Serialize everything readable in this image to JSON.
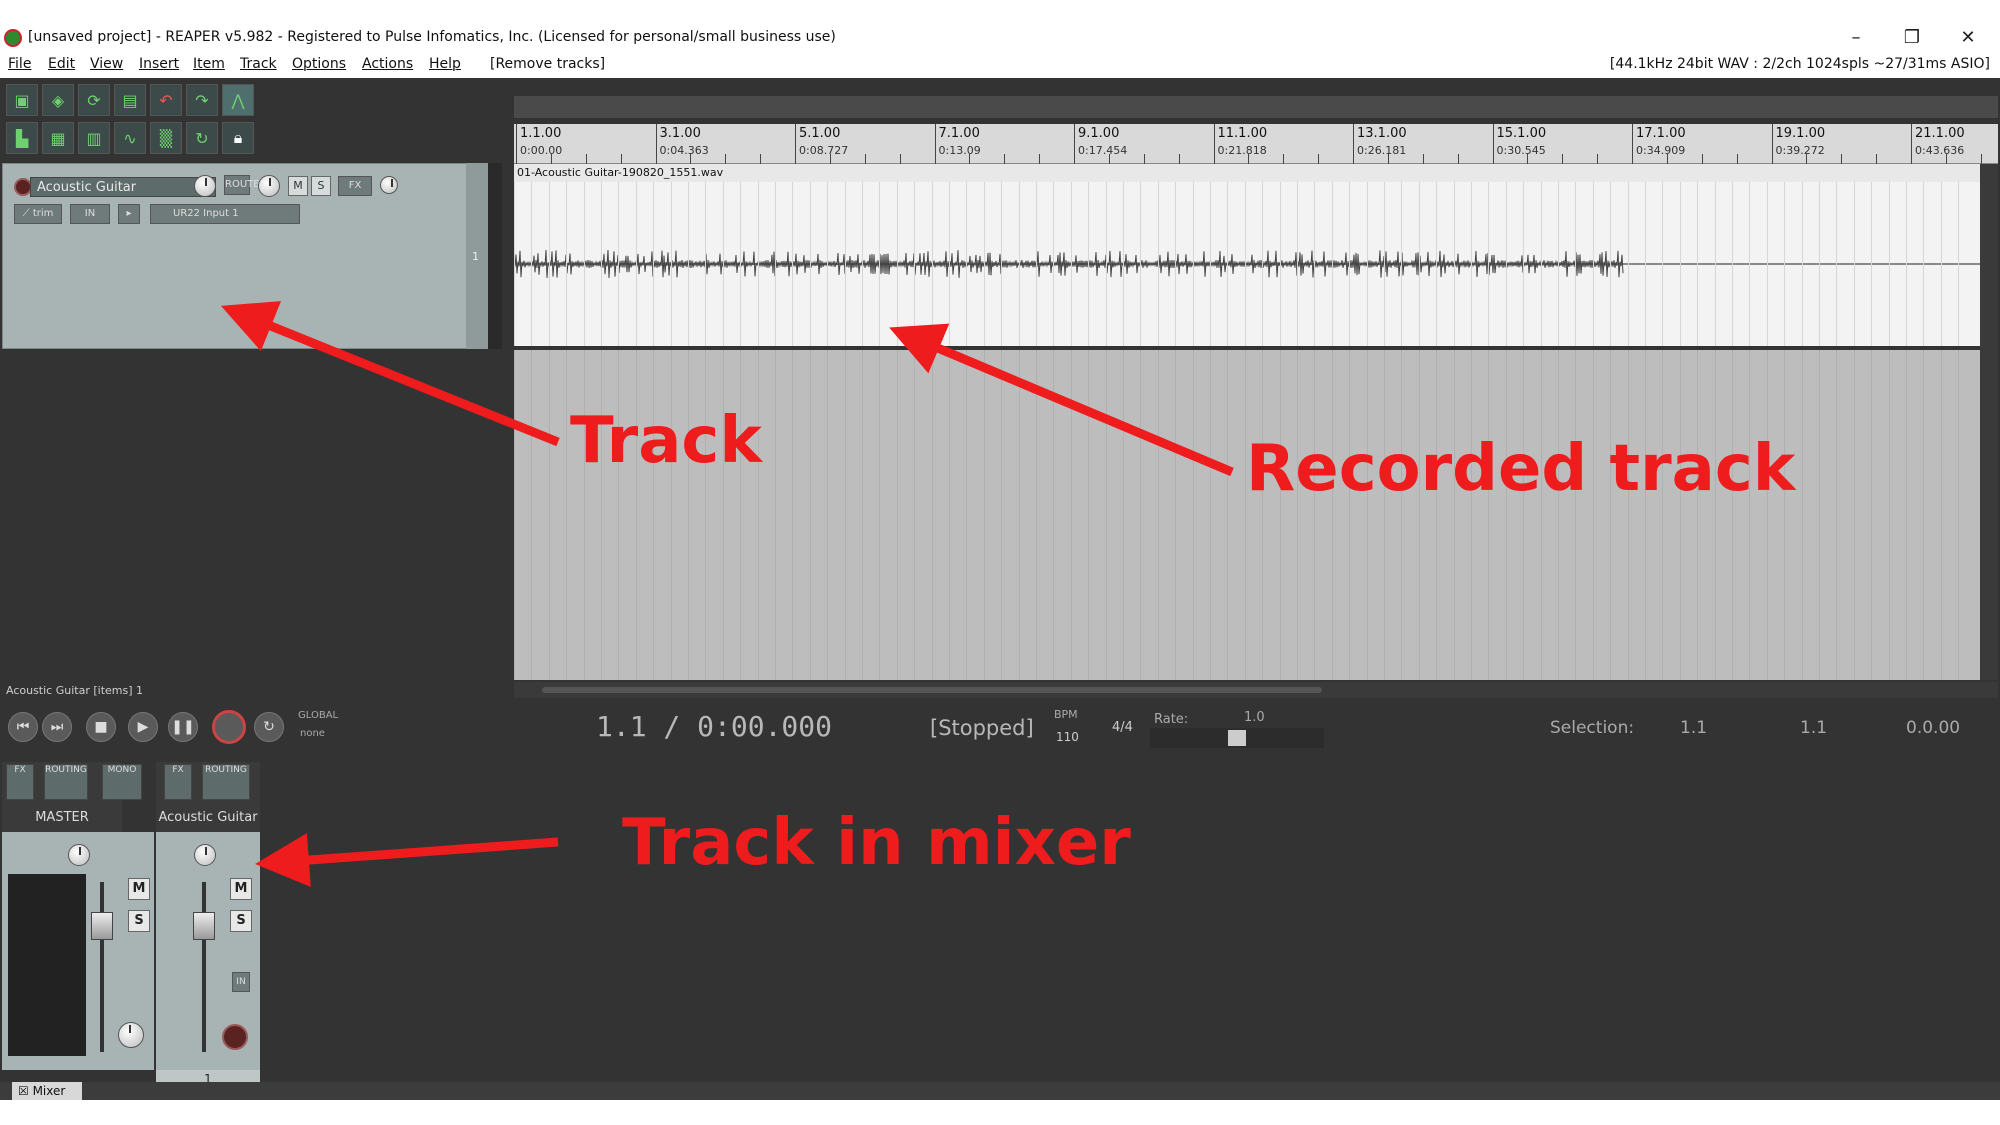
{
  "window": {
    "title": "[unsaved project] - REAPER v5.982 - Registered to Pulse Infomatics, Inc. (Licensed for personal/small business use)",
    "minimize": "–",
    "restore": "❐",
    "close": "✕"
  },
  "menu": {
    "items": [
      "File",
      "Edit",
      "View",
      "Insert",
      "Item",
      "Track",
      "Options",
      "Actions",
      "Help"
    ],
    "extra": "[Remove tracks]",
    "status": "[44.1kHz 24bit WAV : 2/2ch 1024spls ~27/31ms ASIO]"
  },
  "track": {
    "name": "Acoustic Guitar",
    "route_label": "ROUTE",
    "mute_label": "M",
    "solo_label": "S",
    "fx_label": "FX",
    "trim_label": "trim",
    "in_label": "IN",
    "input_label": "UR22 Input 1",
    "number": "1",
    "items_label": "Acoustic Guitar [items] 1"
  },
  "timeline": {
    "ticks": [
      {
        "bar": "1.1.00",
        "time": "0:00.00"
      },
      {
        "bar": "3.1.00",
        "time": "0:04.363"
      },
      {
        "bar": "5.1.00",
        "time": "0:08.727"
      },
      {
        "bar": "7.1.00",
        "time": "0:13.09"
      },
      {
        "bar": "9.1.00",
        "time": "0:17.454"
      },
      {
        "bar": "11.1.00",
        "time": "0:21.818"
      },
      {
        "bar": "13.1.00",
        "time": "0:26.181"
      },
      {
        "bar": "15.1.00",
        "time": "0:30.545"
      },
      {
        "bar": "17.1.00",
        "time": "0:34.909"
      },
      {
        "bar": "19.1.00",
        "time": "0:39.272"
      },
      {
        "bar": "21.1.00",
        "time": "0:43.636"
      }
    ],
    "item_name": "01-Acoustic Guitar-190820_1551.wav"
  },
  "transport": {
    "time": "1.1 / 0:00.000",
    "state": "[Stopped]",
    "global_label": "GLOBAL",
    "global_value": "none",
    "bpm_label": "BPM",
    "bpm": "110",
    "time_signature": "4/4",
    "rate_label": "Rate:",
    "rate": "1.0",
    "selection_label": "Selection:",
    "selection_start": "1.1",
    "selection_end": "1.1",
    "selection_length": "0.0.00"
  },
  "mixer": {
    "master": {
      "name": "MASTER",
      "fx": "FX",
      "routing": "ROUTING",
      "mono": "MONO",
      "mute": "M",
      "solo": "S"
    },
    "track": {
      "name": "Acoustic Guitar",
      "fx": "FX",
      "routing": "ROUTING",
      "mute": "M",
      "solo": "S",
      "in": "IN",
      "number": "1"
    },
    "tab_label": "Mixer"
  },
  "annotations": {
    "track": "Track",
    "recorded_track": "Recorded track",
    "track_in_mixer": "Track in mixer",
    "color": "#ee1c1c"
  }
}
